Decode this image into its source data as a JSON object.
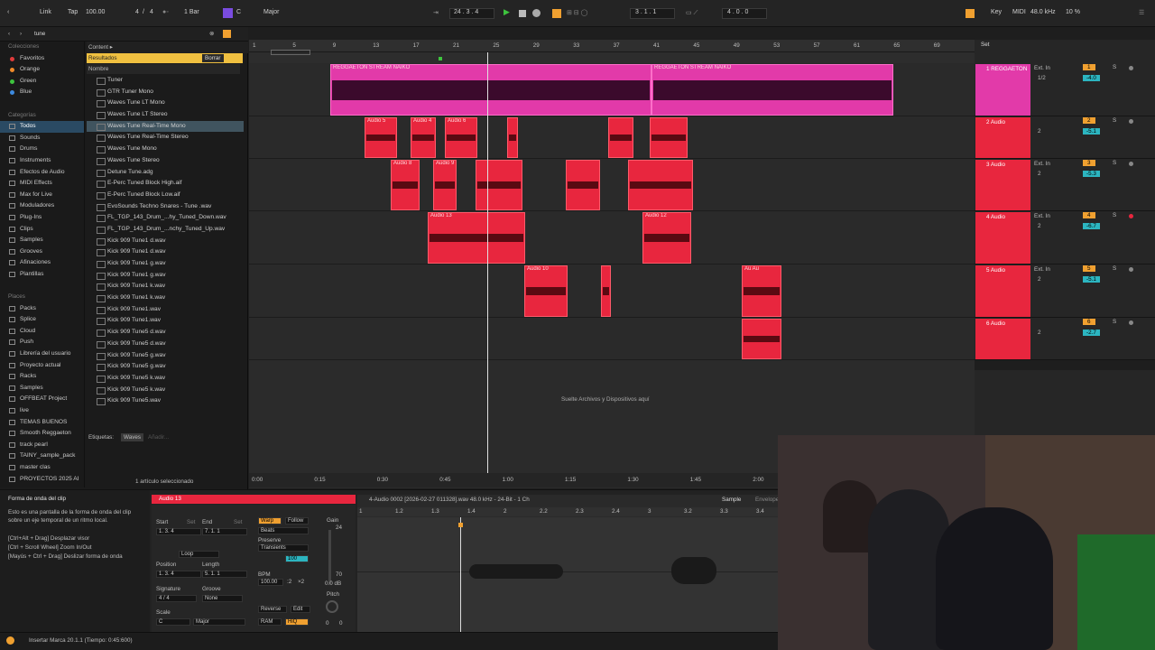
{
  "topbar": {
    "link": "Link",
    "tap": "Tap",
    "tempo": "100.00",
    "sig_num": "4",
    "sig_sep": "/",
    "sig_den": "4",
    "quant": "1 Bar",
    "key_root": "C",
    "key_scale": "Major",
    "pos": "24 .  3 .  4",
    "loop_start": "3 .  1 .  1",
    "loop_len": "4 .  0 .  0",
    "key": "Key",
    "midi": "MIDI",
    "sr": "48.0 kHz",
    "cpu": "10 %"
  },
  "browser": {
    "search": "tune",
    "content": "Content ▸",
    "results": "Resultados",
    "clear": "Borrar",
    "col_name": "Nombre",
    "tags_label": "Etiquetas:",
    "tag": "Waves",
    "tag_add": "Añadir...",
    "selected": "1 artículo seleccionado"
  },
  "categories": [
    {
      "label": "Colecciones",
      "sec": true
    },
    {
      "label": "Favoritos",
      "color": "#e03b3b"
    },
    {
      "label": "Orange",
      "color": "#f08a2a"
    },
    {
      "label": "Green",
      "color": "#3ec43e"
    },
    {
      "label": "Blue",
      "color": "#3d8ae0"
    },
    {
      "label": "",
      "sec": true
    },
    {
      "label": "Categorías",
      "sec": true
    },
    {
      "label": "Todos",
      "sel": true
    },
    {
      "label": "Sounds"
    },
    {
      "label": "Drums"
    },
    {
      "label": "Instruments"
    },
    {
      "label": "Efectos de Audio"
    },
    {
      "label": "MIDI Effects"
    },
    {
      "label": "Max for Live"
    },
    {
      "label": "Moduladores"
    },
    {
      "label": "Plug-Ins"
    },
    {
      "label": "Clips"
    },
    {
      "label": "Samples"
    },
    {
      "label": "Grooves"
    },
    {
      "label": "Afinaciones"
    },
    {
      "label": "Plantillas"
    },
    {
      "label": "",
      "sec": true
    },
    {
      "label": "Places",
      "sec": true
    },
    {
      "label": "Packs"
    },
    {
      "label": "Splice"
    },
    {
      "label": "Cloud"
    },
    {
      "label": "Push"
    },
    {
      "label": "Librería del usuario"
    },
    {
      "label": "Proyecto actual"
    },
    {
      "label": "Racks"
    },
    {
      "label": "Samples"
    },
    {
      "label": "OFFBEAT Project"
    },
    {
      "label": "live"
    },
    {
      "label": "TEMAS BUENOS"
    },
    {
      "label": "Smooth Reggaeton"
    },
    {
      "label": "track pearl"
    },
    {
      "label": "TAINY_sample_pack"
    },
    {
      "label": "master clas"
    },
    {
      "label": "PROYECTOS 2025 AI"
    }
  ],
  "results": [
    "Tuner",
    "GTR Tuner Mono",
    "Waves Tune LT Mono",
    "Waves Tune LT Stereo",
    "Waves Tune Real-Time Mono",
    "Waves Tune Real-Time Stereo",
    "Waves Tune Mono",
    "Waves Tune Stereo",
    "Detune Tune.adg",
    "E-Perc Tuned Block High.aif",
    "E-Perc Tuned Block Low.aif",
    "EvoSounds Techno Snares - Tune .wav",
    "FL_TGP_143_Drum_...hy_Tuned_Down.wav",
    "FL_TGP_143_Drum_...nchy_Tuned_Up.wav",
    "Kick 909 Tune1 d.wav",
    "Kick 909 Tune1 d.wav",
    "Kick 909 Tune1 g.wav",
    "Kick 909 Tune1 g.wav",
    "Kick 909 Tune1 k.wav",
    "Kick 909 Tune1 k.wav",
    "Kick 909 Tune1.wav",
    "Kick 909 Tune1.wav",
    "Kick 909 Tune5 d.wav",
    "Kick 909 Tune5 d.wav",
    "Kick 909 Tune5 g.wav",
    "Kick 909 Tune5 g.wav",
    "Kick 909 Tune5 k.wav",
    "Kick 909 Tune5 k.wav",
    "Kick 909 Tune5.wav"
  ],
  "ruler": [
    "1",
    "5",
    "9",
    "13",
    "17",
    "21",
    "25",
    "29",
    "33",
    "37",
    "41",
    "45",
    "49",
    "53",
    "57",
    "61",
    "65",
    "69"
  ],
  "timeline": [
    "0:00",
    "0:15",
    "0:30",
    "0:45",
    "1:00",
    "1:15",
    "1:30",
    "1:45",
    "2:00"
  ],
  "arrangement": {
    "drop": "Suelte Archivos y Dispositivos aquí",
    "set": "Set"
  },
  "tracks": [
    {
      "name": "1 REGGAETON",
      "num": "1",
      "input": "Ext. In",
      "ch": "1/2",
      "vol": "-4.0"
    },
    {
      "name": "2 Audio",
      "num": "2",
      "input": "",
      "ch": "2",
      "vol": "-5.1"
    },
    {
      "name": "3 Audio",
      "num": "3",
      "input": "Ext. In",
      "ch": "2",
      "vol": "-5.3"
    },
    {
      "name": "4 Audio",
      "num": "4",
      "input": "Ext. In",
      "ch": "2",
      "vol": "-6.7"
    },
    {
      "name": "5 Audio",
      "num": "5",
      "input": "Ext. In",
      "ch": "2",
      "vol": "-5.1"
    },
    {
      "name": "6 Audio",
      "num": "6",
      "input": "",
      "ch": "2",
      "vol": "-2.7"
    }
  ],
  "clips": {
    "pink1": "REGGAETON STREAM NAIKO",
    "pink2": "REGGAETON STREAM NAIKO",
    "a5": "Audio 5",
    "a4": "Audio 4",
    "a6": "Audio 6",
    "a8": "Audio 8",
    "a9": "Audio 9",
    "a13": "Audio 13",
    "a12": "Audio 12",
    "a10": "Audio 10",
    "a7": "Au Au"
  },
  "info": {
    "title": "Forma de onda del clip",
    "body": "Esto es una pantalla de la forma de onda del clip sobre un eje temporal de un ritmo local.",
    "k1": "[Ctrl+Alt + Drag] Desplazar visor",
    "k2": "[Ctrl + Scroll Wheel] Zoom In/Out",
    "k3": "[Mayús + Ctrl + Drag] Deslizar forma de onda"
  },
  "clipview": {
    "name": "Audio 13",
    "file": "4-Audio 0002 [2026-02-27 011328].wav  48.0 kHz - 24-Bit - 1 Ch",
    "sample": "Sample",
    "envelope": "Envelope",
    "start": "Start",
    "set": "Set",
    "end": "End",
    "start_v": "1.  3.  4",
    "end_v": "7.  1.  1",
    "loop": "Loop",
    "position": "Position",
    "length": "Length",
    "pos_v": "1.  3.  4",
    "len_v": "5.  1.  1",
    "signature": "Signature",
    "groove": "Groove",
    "sig_v": "4  /  4",
    "groove_v": "None",
    "scale": "Scale",
    "scale_root": "C",
    "scale_v": "Major",
    "warp": "Warp",
    "follow": "Follow",
    "beats": "Beats",
    "preserve": "Preserve",
    "transients": "Transients",
    "bpm": "BPM",
    "bpm_v": "100.00",
    "half": ":2",
    "dbl": "×2",
    "reverse": "Reverse",
    "edit": "Edit",
    "ram": "RAM",
    "hiq": "HiQ",
    "gain": "Gain",
    "gain_v": "0.0 dB",
    "pitch": "Pitch",
    "pitch_v": "0",
    "detune_v": "0",
    "g24": "24",
    "g70": "70",
    "hundred": "100",
    "ticks": [
      "1",
      "1.2",
      "1.3",
      "1.4",
      "2",
      "2.2",
      "2.3",
      "2.4",
      "3",
      "3.2",
      "3.3",
      "3.4"
    ]
  },
  "status": {
    "text": "Insertar Marca 20.1.1 (Tiempo: 0:45:600)"
  }
}
